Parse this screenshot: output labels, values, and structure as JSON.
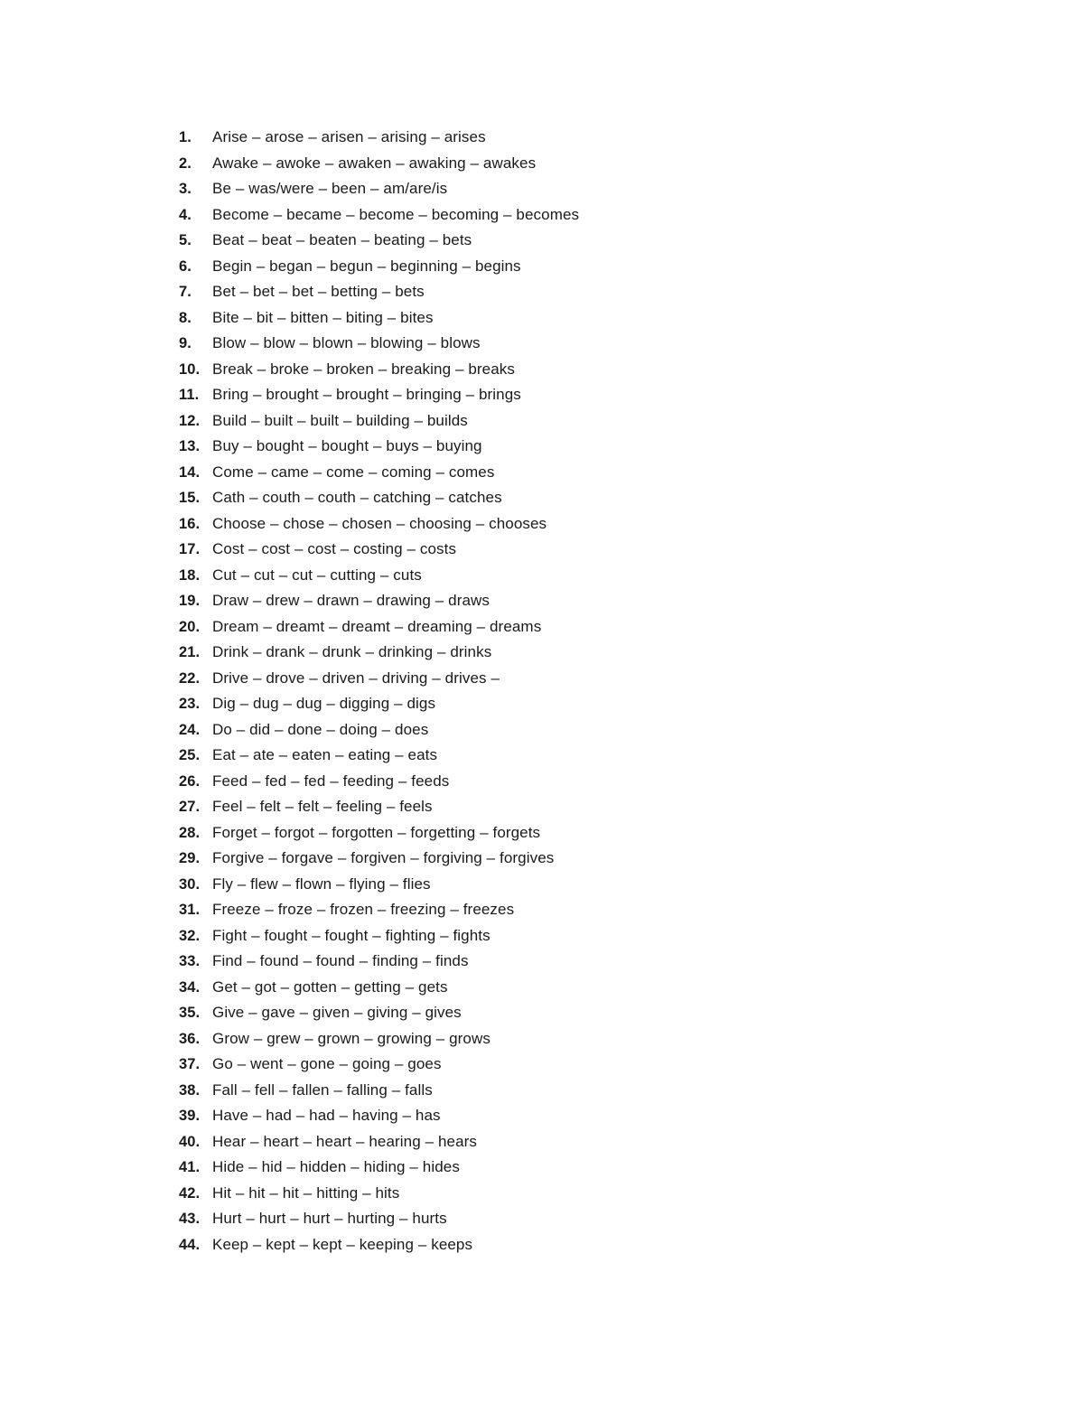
{
  "document": {
    "background_color": "#ffffff",
    "text_color": "#1a1a1a",
    "list": {
      "name": "irregular-verbs-list",
      "items": [
        {
          "number": "1.",
          "text": "Arise – arose – arisen – arising – arises"
        },
        {
          "number": "2.",
          "text": "Awake – awoke – awaken – awaking – awakes"
        },
        {
          "number": "3.",
          "text": "Be – was/were – been – am/are/is"
        },
        {
          "number": "4.",
          "text": "Become – became – become – becoming – becomes"
        },
        {
          "number": "5.",
          "text": "Beat – beat – beaten – beating – bets"
        },
        {
          "number": "6.",
          "text": "Begin – began – begun – beginning – begins"
        },
        {
          "number": "7.",
          "text": "Bet – bet – bet – betting – bets"
        },
        {
          "number": "8.",
          "text": "Bite – bit – bitten – biting – bites"
        },
        {
          "number": "9.",
          "text": "Blow – blow – blown – blowing – blows"
        },
        {
          "number": "10.",
          "text": "Break – broke – broken – breaking – breaks"
        },
        {
          "number": "11.",
          "text": "Bring – brought – brought – bringing – brings"
        },
        {
          "number": "12.",
          "text": "Build – built – built – building – builds"
        },
        {
          "number": "13.",
          "text": "Buy – bought – bought – buys – buying"
        },
        {
          "number": "14.",
          "text": "Come – came – come – coming – comes"
        },
        {
          "number": "15.",
          "text": "Cath – couth – couth – catching – catches"
        },
        {
          "number": "16.",
          "text": "Choose – chose – chosen – choosing – chooses"
        },
        {
          "number": "17.",
          "text": "Cost – cost – cost – costing – costs"
        },
        {
          "number": "18.",
          "text": "Cut – cut – cut – cutting – cuts"
        },
        {
          "number": "19.",
          "text": "Draw – drew – drawn – drawing – draws"
        },
        {
          "number": "20.",
          "text": "Dream – dreamt – dreamt – dreaming – dreams"
        },
        {
          "number": "21.",
          "text": "Drink – drank – drunk – drinking – drinks"
        },
        {
          "number": "22.",
          "text": "Drive – drove – driven – driving – drives –"
        },
        {
          "number": "23.",
          "text": "Dig – dug – dug – digging – digs"
        },
        {
          "number": "24.",
          "text": "Do – did – done – doing – does"
        },
        {
          "number": "25.",
          "text": "Eat – ate – eaten – eating – eats"
        },
        {
          "number": "26.",
          "text": "Feed – fed – fed – feeding – feeds"
        },
        {
          "number": "27.",
          "text": "Feel – felt – felt – feeling – feels"
        },
        {
          "number": "28.",
          "text": "Forget – forgot – forgotten – forgetting – forgets"
        },
        {
          "number": "29.",
          "text": "Forgive – forgave – forgiven – forgiving – forgives"
        },
        {
          "number": "30.",
          "text": "Fly – flew – flown – flying – flies"
        },
        {
          "number": "31.",
          "text": "Freeze – froze – frozen – freezing – freezes"
        },
        {
          "number": "32.",
          "text": "Fight – fought – fought – fighting – fights"
        },
        {
          "number": "33.",
          "text": "Find – found – found – finding – finds"
        },
        {
          "number": "34.",
          "text": "Get – got – gotten – getting – gets"
        },
        {
          "number": "35.",
          "text": "Give – gave – given – giving – gives"
        },
        {
          "number": "36.",
          "text": "Grow – grew – grown – growing – grows"
        },
        {
          "number": "37.",
          "text": "Go – went – gone – going – goes"
        },
        {
          "number": "38.",
          "text": "Fall – fell – fallen – falling – falls"
        },
        {
          "number": "39.",
          "text": "Have – had – had – having – has"
        },
        {
          "number": "40.",
          "text": "Hear – heart – heart – hearing – hears"
        },
        {
          "number": "41.",
          "text": "Hide – hid – hidden – hiding – hides"
        },
        {
          "number": "42.",
          "text": "Hit – hit – hit – hitting – hits"
        },
        {
          "number": "43.",
          "text": "Hurt – hurt – hurt – hurting – hurts"
        },
        {
          "number": "44.",
          "text": "Keep – kept – kept – keeping – keeps"
        }
      ]
    }
  }
}
